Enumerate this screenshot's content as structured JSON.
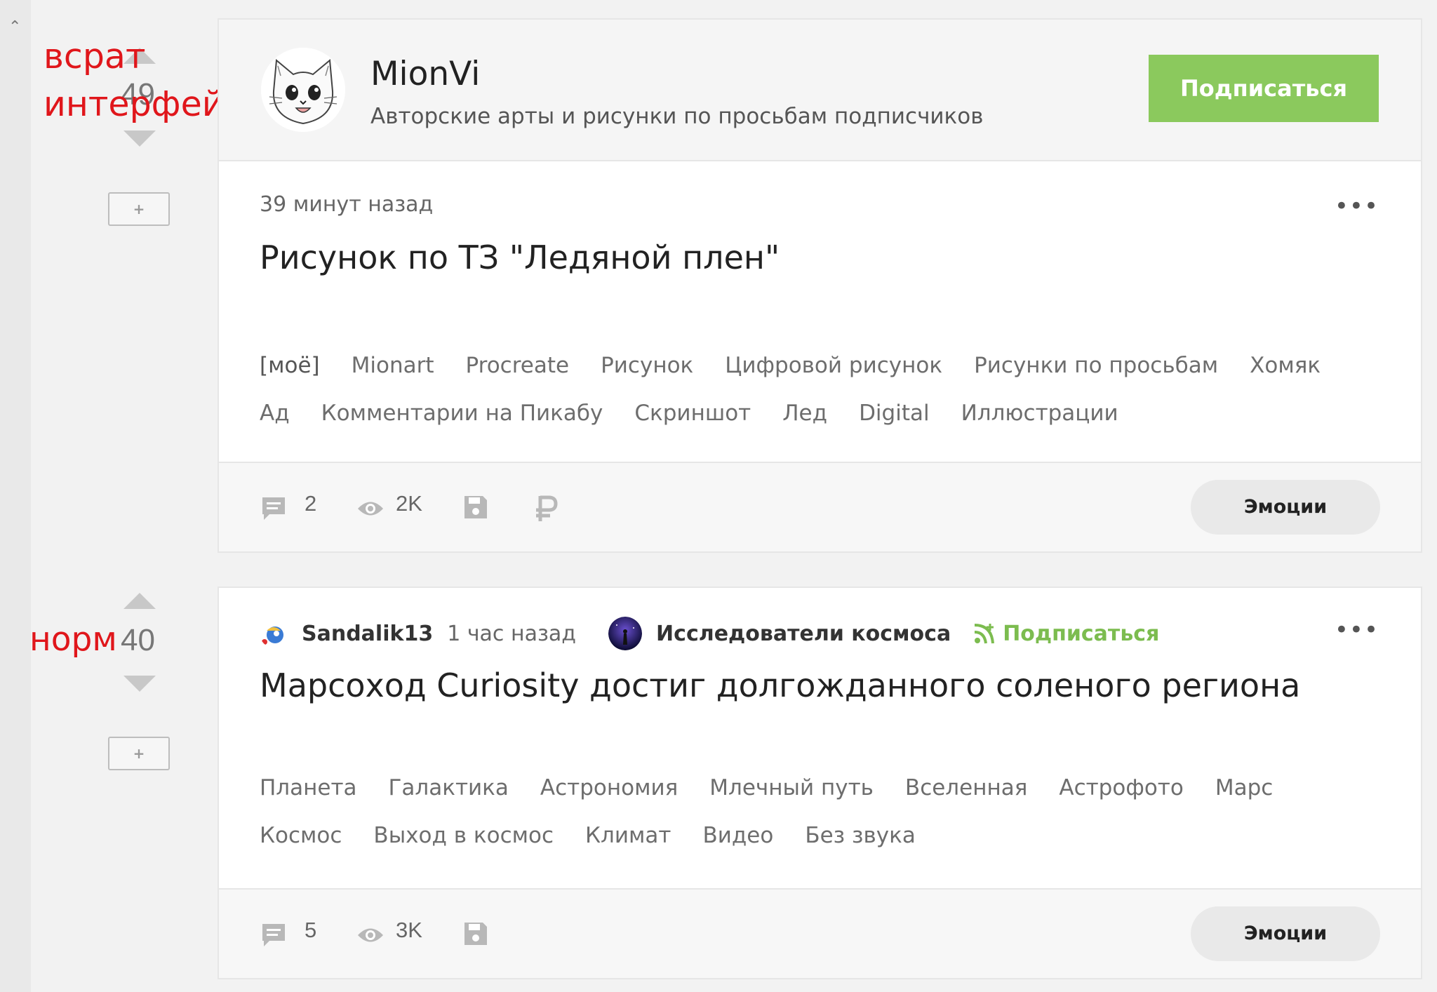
{
  "annotations": {
    "post1_line1": "всрат",
    "post1_line2": "интерфейс",
    "post2": "норм"
  },
  "colors": {
    "accent_green": "#8bc95d",
    "annotation_red": "#e0161b"
  },
  "posts": [
    {
      "rating": "49",
      "add_label": "+",
      "author": {
        "name": "MionVi",
        "description": "Авторские арты и рисунки по просьбам подписчиков",
        "subscribe_label": "Подписаться"
      },
      "time": "39 минут назад",
      "more_label": "•••",
      "title": "Рисунок по ТЗ \"Ледяной плен\"",
      "tags": [
        "[моё]",
        "Mionart",
        "Procreate",
        "Рисунок",
        "Цифровой рисунок",
        "Рисунки по просьбам",
        "Хомяк",
        "Ад",
        "Комментарии на Пикабу",
        "Скриншот",
        "Лед",
        "Digital",
        "Иллюстрации"
      ],
      "comments": "2",
      "views": "2K",
      "emotions_label": "Эмоции",
      "icons": [
        "comment-icon",
        "eye-icon",
        "save-icon",
        "ruble-icon"
      ]
    },
    {
      "rating": "40",
      "add_label": "+",
      "user": "Sandalik13",
      "time": "1 час назад",
      "community": "Исследователи космоса",
      "subscribe_label": "Подписаться",
      "more_label": "•••",
      "title": "Марсоход Curiosity достиг долгожданного соленого региона",
      "tags": [
        "Планета",
        "Галактика",
        "Астрономия",
        "Млечный путь",
        "Вселенная",
        "Астрофото",
        "Марс",
        "Космос",
        "Выход в космос",
        "Климат",
        "Видео",
        "Без звука"
      ],
      "comments": "5",
      "views": "3K",
      "emotions_label": "Эмоции",
      "icons": [
        "comment-icon",
        "eye-icon",
        "save-icon"
      ]
    }
  ]
}
